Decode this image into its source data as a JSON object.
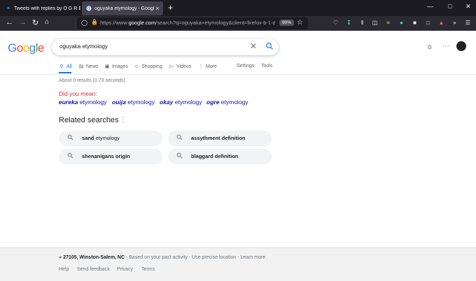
{
  "browser": {
    "tabs": [
      {
        "title": "Tweets with replies by O G R E",
        "icon": "twitter-icon",
        "active": false
      },
      {
        "title": "oguyaka etymology - Google Se",
        "icon": "google-icon",
        "active": true
      }
    ],
    "new_tab": "+",
    "url_prefix": "https://www.",
    "url_domain": "google.com",
    "url_rest": "/search?q=oguyaka+etymology&client=firefox-b-1-d&",
    "zoom": "90%"
  },
  "google": {
    "logo": "Google",
    "query": "oguyaka etymology",
    "tabs": [
      {
        "label": "All",
        "icon": "search-icon",
        "selected": true
      },
      {
        "label": "News",
        "icon": "news-icon",
        "selected": false
      },
      {
        "label": "Images",
        "icon": "image-icon",
        "selected": false
      },
      {
        "label": "Shopping",
        "icon": "tag-icon",
        "selected": false
      },
      {
        "label": "Videos",
        "icon": "play-icon",
        "selected": false
      },
      {
        "label": "More",
        "icon": "more-dots-icon",
        "selected": false
      }
    ],
    "settings_label": "Settings",
    "tools_label": "Tools",
    "result_stats": "About 0 results (0.73 seconds)",
    "did_you_mean": "Did you mean:",
    "suggestions": [
      {
        "bold": "eureka",
        "rest": " etymology"
      },
      {
        "bold": "ouija",
        "rest": " etymology"
      },
      {
        "bold": "okay",
        "rest": " etymology"
      },
      {
        "bold": "ogre",
        "rest": " etymology"
      }
    ],
    "related_title": "Related searches",
    "related": [
      {
        "bold": "sand",
        "rest": " etymology"
      },
      {
        "bold": "assythment definition",
        "rest": ""
      },
      {
        "bold": "shenanigans origin",
        "rest": ""
      },
      {
        "bold": "blaggard definition",
        "rest": ""
      }
    ],
    "footer": {
      "location": "27105, Winston-Salem, NC",
      "location_note": " - Based on your past activity - ",
      "precise": "Use precise location",
      "learn_more": " - Learn more",
      "links": [
        "Help",
        "Send feedback",
        "Privacy",
        "Terms"
      ]
    }
  },
  "colors": {
    "accent": "#1a73e8",
    "link": "#1a0dab",
    "did_you_mean": "#d93025"
  }
}
